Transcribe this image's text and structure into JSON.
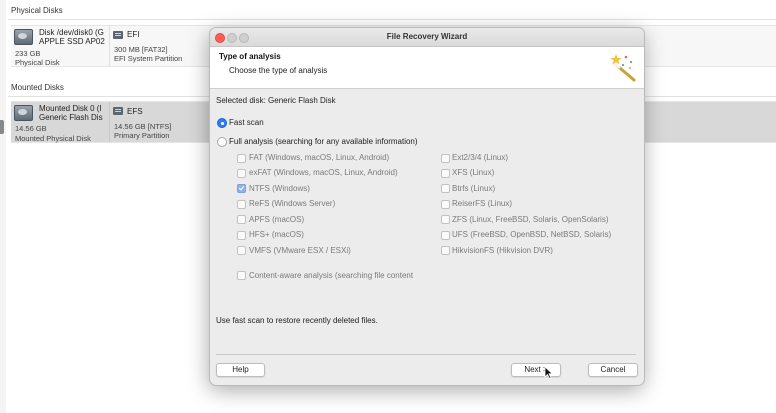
{
  "background": {
    "physical_section_label": "Physical Disks",
    "mounted_section_label": "Mounted Disks",
    "physical_disk": {
      "name_line1": "Disk /dev/disk0 (G",
      "name_line2": "APPLE SSD AP02",
      "size": "233 GB",
      "type": "Physical Disk",
      "partition_name": "EFI",
      "partition_size": "300 MB [FAT32]",
      "partition_desc": "EFI System Partition"
    },
    "mounted_disk": {
      "name_line1": "Mounted Disk 0 (I",
      "name_line2": "Generic Flash Dis",
      "size": "14.56 GB",
      "type": "Mounted Physical Disk",
      "partition_name": "EFS",
      "partition_size": "14.56 GB [NTFS]",
      "partition_desc": "Primary Partition"
    }
  },
  "dialog": {
    "title": "File Recovery Wizard",
    "header_title": "Type of analysis",
    "header_subtitle": "Choose the type of analysis",
    "selected_disk": "Selected disk: Generic Flash Disk",
    "fast_scan_label": "Fast scan",
    "full_analysis_label": "Full analysis (searching for any available information)",
    "fast_scan_selected": true,
    "filesystems_left": [
      {
        "label": "FAT (Windows, macOS, Linux, Android)",
        "checked": false
      },
      {
        "label": "exFAT (Windows, macOS, Linux, Android)",
        "checked": false
      },
      {
        "label": "NTFS (Windows)",
        "checked": true
      },
      {
        "label": "ReFS (Windows Server)",
        "checked": false
      },
      {
        "label": "APFS (macOS)",
        "checked": false
      },
      {
        "label": "HFS+ (macOS)",
        "checked": false
      },
      {
        "label": "VMFS (VMware ESX / ESXi)",
        "checked": false
      }
    ],
    "filesystems_right": [
      {
        "label": "Ext2/3/4 (Linux)",
        "checked": false
      },
      {
        "label": "XFS (Linux)",
        "checked": false
      },
      {
        "label": "Btrfs (Linux)",
        "checked": false
      },
      {
        "label": "ReiserFS (Linux)",
        "checked": false
      },
      {
        "label": "ZFS (Linux, FreeBSD, Solaris, OpenSolaris)",
        "checked": false
      },
      {
        "label": "UFS (FreeBSD, OpenBSD, NetBSD, Solaris)",
        "checked": false
      },
      {
        "label": "HikvisionFS (Hikvision DVR)",
        "checked": false
      }
    ],
    "content_aware_label": "Content-aware analysis (searching file content",
    "hint": "Use fast scan to restore recently deleted files.",
    "help_button": "Help",
    "next_button": "Next >",
    "cancel_button": "Cancel",
    "accent_color": "#2f7cf6"
  }
}
